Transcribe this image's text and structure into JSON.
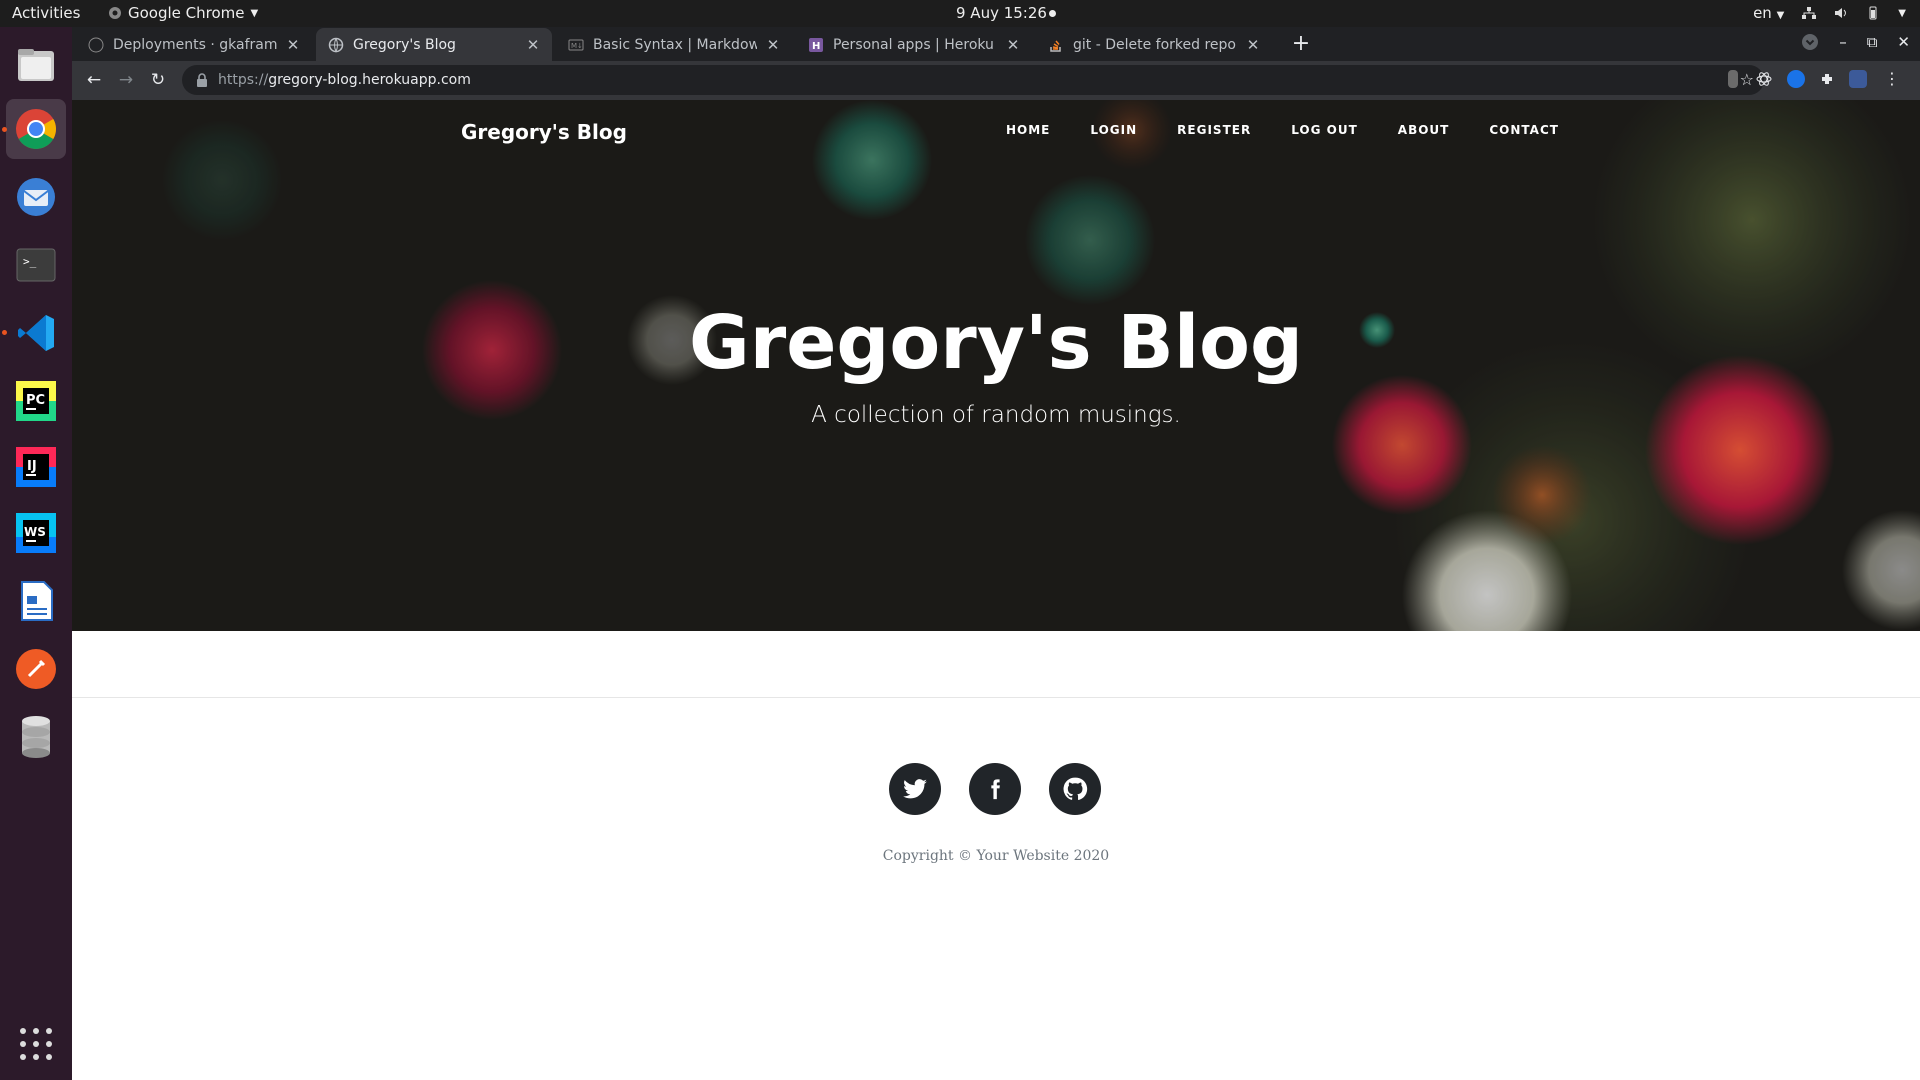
{
  "system_bar": {
    "activities": "Activities",
    "app_name": "Google Chrome",
    "datetime": "9 Auy  15:26",
    "language": "en"
  },
  "dock": {
    "items": [
      "files",
      "google-chrome",
      "thunderbird",
      "terminal",
      "vscode",
      "pycharm",
      "intellij-idea",
      "webstorm",
      "libreoffice-writer",
      "postman",
      "database"
    ]
  },
  "browser": {
    "tabs": [
      {
        "title": "Deployments · gkaframan",
        "active": false
      },
      {
        "title": "Gregory's Blog",
        "active": true
      },
      {
        "title": "Basic Syntax | Markdown",
        "active": false
      },
      {
        "title": "Personal apps | Heroku",
        "active": false
      },
      {
        "title": "git - Delete forked repo fr",
        "active": false
      }
    ],
    "url_scheme": "https://",
    "url_host": "gregory-blog.herokuapp.com"
  },
  "site": {
    "brand": "Gregory's Blog",
    "nav": [
      "HOME",
      "LOGIN",
      "REGISTER",
      "LOG OUT",
      "ABOUT",
      "CONTACT"
    ],
    "hero_title": "Gregory's Blog",
    "hero_subtitle": "A collection of random musings.",
    "social": [
      "twitter-icon",
      "facebook-icon",
      "github-icon"
    ],
    "copyright": "Copyright © Your Website 2020"
  }
}
